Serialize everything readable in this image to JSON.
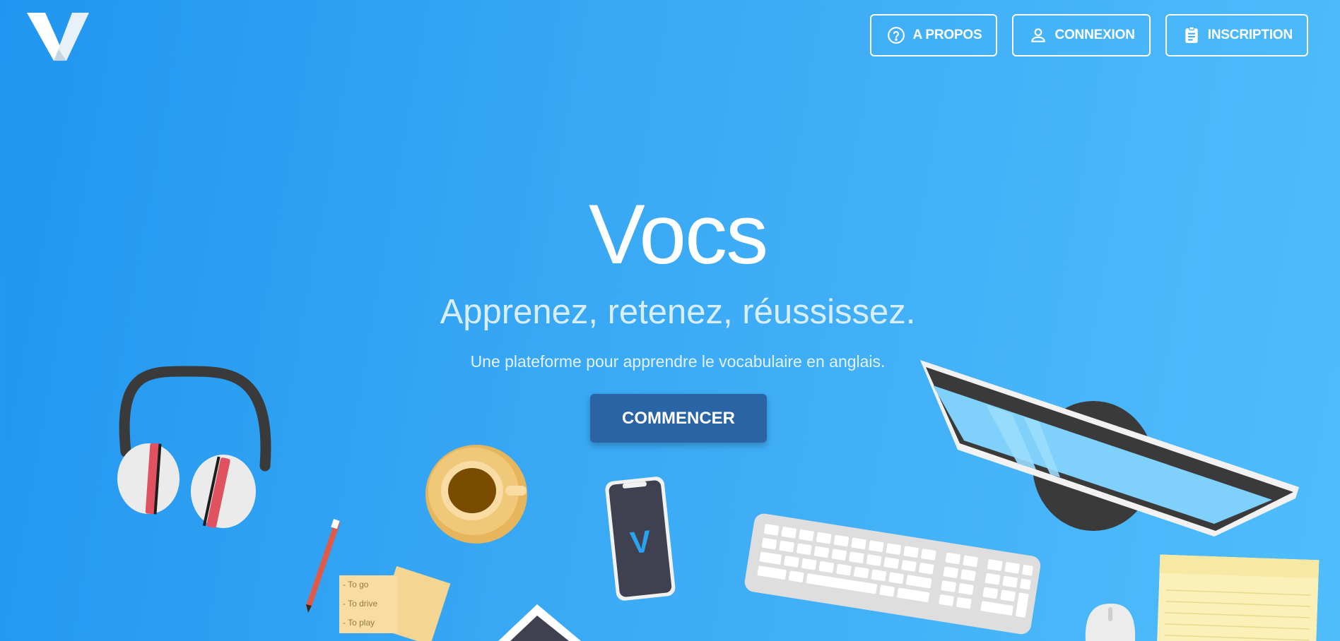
{
  "header": {
    "logo_icon": "v-logo-icon",
    "nav": [
      {
        "label": "A PROPOS",
        "icon": "help-circle-icon"
      },
      {
        "label": "CONNEXION",
        "icon": "user-icon"
      },
      {
        "label": "INSCRIPTION",
        "icon": "clipboard-icon"
      }
    ]
  },
  "hero": {
    "title": "Vocs",
    "tagline": "Apprenez, retenez, réussissez.",
    "subtitle": "Une plateforme pour apprendre le vocabulaire en anglais.",
    "cta_label": "COMMENCER"
  },
  "illustration": {
    "sticky_note_lines": [
      "- To go",
      "- To drive",
      "- To play"
    ],
    "phone_logo": "V"
  },
  "colors": {
    "background_start": "#2196f0",
    "background_end": "#50bdfb",
    "cta_background": "#2a64a4",
    "text": "#ffffff"
  }
}
